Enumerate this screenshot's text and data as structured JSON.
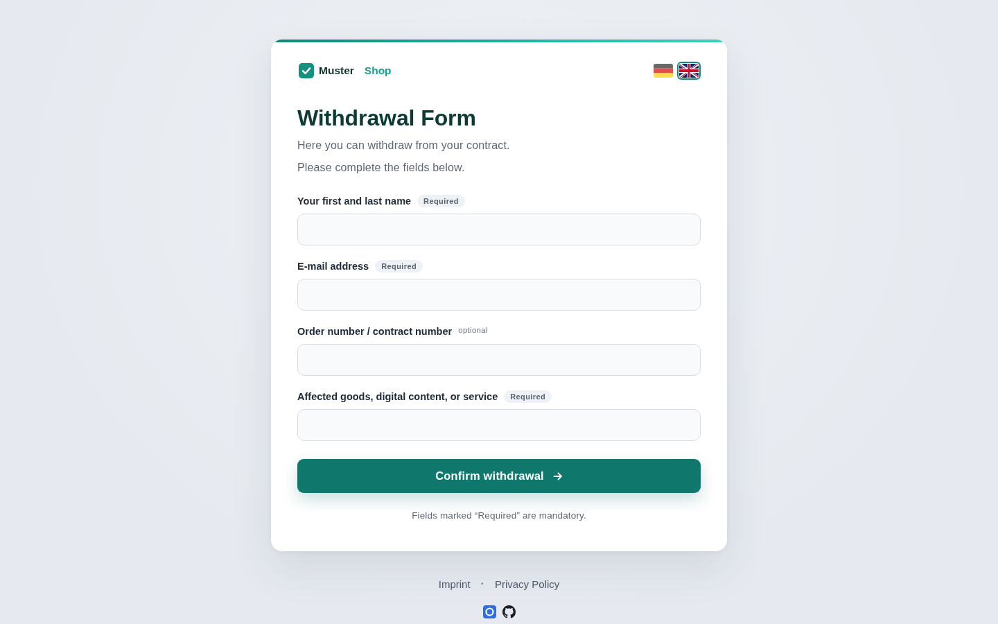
{
  "header": {
    "brand": {
      "name": "Muster",
      "suffix": "Shop"
    },
    "languages": [
      {
        "kind": "de",
        "selected": false
      },
      {
        "kind": "gb",
        "selected": true
      }
    ]
  },
  "title": "Withdrawal Form",
  "intro": [
    "Here you can withdraw from your contract.",
    "Please complete the fields below."
  ],
  "fields": [
    {
      "label": "Your first and last name",
      "tag": {
        "text": "Required",
        "kind": "badge"
      }
    },
    {
      "label": "E-mail address",
      "tag": {
        "text": "Required",
        "kind": "badge"
      }
    },
    {
      "label": "Order number / contract number",
      "tag": {
        "text": "optional",
        "kind": "plain"
      }
    },
    {
      "label": "Affected goods, digital content, or service",
      "tag": {
        "text": "Required",
        "kind": "badge"
      }
    }
  ],
  "submit_button": "Confirm withdrawal",
  "note": "Fields marked “Required” are mandatory.",
  "footer": {
    "links": [
      "Imprint",
      "Privacy Policy"
    ],
    "separator": "·"
  }
}
